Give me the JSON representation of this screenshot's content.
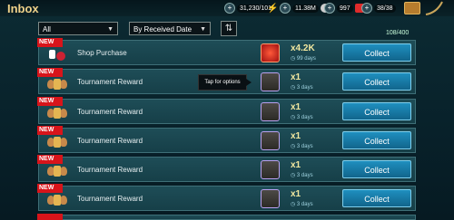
{
  "header": {
    "title": "Inbox",
    "resources": [
      {
        "name": "silver",
        "value": "31,230/101",
        "icon": "silver-coin-icon"
      },
      {
        "name": "energy",
        "value": "11.38M",
        "icon": "energy-icon"
      },
      {
        "name": "gems",
        "value": "997",
        "icon": "ruby-icon"
      },
      {
        "name": "keys",
        "value": "38/38",
        "icon": "key-icon"
      }
    ]
  },
  "filters": {
    "category": "All",
    "sort": "By Received Date",
    "count": "108/400"
  },
  "tooltip": "Tap for options",
  "rows": [
    {
      "new": "NEW",
      "label": "Shop Purchase",
      "qty": "x4.2K",
      "days": "99 days",
      "action": "Collect"
    },
    {
      "new": "NEW",
      "label": "Tournament Reward",
      "qty": "x1",
      "days": "3 days",
      "action": "Collect"
    },
    {
      "new": "NEW",
      "label": "Tournament Reward",
      "qty": "x1",
      "days": "3 days",
      "action": "Collect"
    },
    {
      "new": "NEW",
      "label": "Tournament Reward",
      "qty": "x1",
      "days": "3 days",
      "action": "Collect"
    },
    {
      "new": "NEW",
      "label": "Tournament Reward",
      "qty": "x1",
      "days": "3 days",
      "action": "Collect"
    },
    {
      "new": "NEW",
      "label": "Tournament Reward",
      "qty": "x1",
      "days": "3 days",
      "action": "Collect"
    }
  ]
}
